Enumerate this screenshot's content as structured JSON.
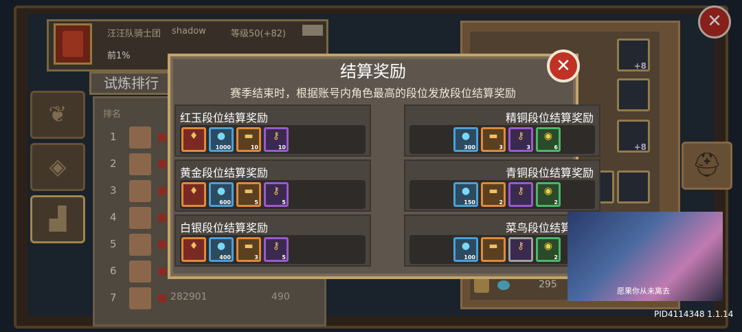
{
  "header": {
    "guild": "汪汪队骑士团",
    "player": "shadow",
    "level": "等级50(+82)",
    "rank_pct": "前1%",
    "tab": "试炼排行"
  },
  "rank_list": {
    "header_label": "排名",
    "rows": [
      {
        "rank": "1",
        "id": "",
        "score": ""
      },
      {
        "rank": "2",
        "id": "",
        "score": ""
      },
      {
        "rank": "3",
        "id": "",
        "score": ""
      },
      {
        "rank": "4",
        "id": "",
        "score": ""
      },
      {
        "rank": "5",
        "id": "",
        "score": ""
      },
      {
        "rank": "6",
        "id": "",
        "score": ""
      },
      {
        "rank": "7",
        "id": "282901",
        "score": "490"
      }
    ]
  },
  "right_panel": {
    "slot_badges": [
      "+8",
      "",
      "+8"
    ],
    "coin_value": "295"
  },
  "modal": {
    "title": "结算奖励",
    "subtitle": "赛季结束时，根据账号内角色最高的段位发放段位结算奖励",
    "tiers": [
      {
        "label": "红玉段位结算奖励",
        "items": [
          {
            "kind": "gem",
            "icon": "chest-icon",
            "qty": ""
          },
          {
            "kind": "crystal",
            "icon": "crystal-icon",
            "qty": "1000"
          },
          {
            "kind": "ticket",
            "icon": "ticket-icon",
            "qty": "10"
          },
          {
            "kind": "key",
            "icon": "key-icon",
            "qty": "10"
          }
        ]
      },
      {
        "label": "精铜段位结算奖励",
        "items": [
          {
            "kind": "crystal",
            "icon": "crystal-icon",
            "qty": "300"
          },
          {
            "kind": "ticket",
            "icon": "ticket-icon",
            "qty": "3"
          },
          {
            "kind": "key",
            "icon": "key-icon",
            "qty": "3"
          },
          {
            "kind": "coin",
            "icon": "coin-icon",
            "qty": "6"
          }
        ]
      },
      {
        "label": "黄金段位结算奖励",
        "items": [
          {
            "kind": "gem",
            "icon": "chest-icon",
            "qty": ""
          },
          {
            "kind": "crystal",
            "icon": "crystal-icon",
            "qty": "600"
          },
          {
            "kind": "ticket",
            "icon": "ticket-icon",
            "qty": "5"
          },
          {
            "kind": "key",
            "icon": "key-icon",
            "qty": "5"
          }
        ]
      },
      {
        "label": "青铜段位结算奖励",
        "items": [
          {
            "kind": "crystal",
            "icon": "crystal-icon",
            "qty": "150"
          },
          {
            "kind": "ticket",
            "icon": "ticket-icon",
            "qty": "2"
          },
          {
            "kind": "key",
            "icon": "key-icon",
            "qty": ""
          },
          {
            "kind": "coin",
            "icon": "coin-icon",
            "qty": "2"
          }
        ]
      },
      {
        "label": "白银段位结算奖励",
        "items": [
          {
            "kind": "gem",
            "icon": "chest-icon",
            "qty": ""
          },
          {
            "kind": "crystal",
            "icon": "crystal-icon",
            "qty": "400"
          },
          {
            "kind": "ticket",
            "icon": "ticket-icon",
            "qty": "3"
          },
          {
            "kind": "key",
            "icon": "key-icon",
            "qty": "5"
          }
        ]
      },
      {
        "label": "菜鸟段位结算奖励",
        "items": [
          {
            "kind": "crystal",
            "icon": "crystal-icon",
            "qty": "100"
          },
          {
            "kind": "ticket",
            "icon": "ticket-icon",
            "qty": ""
          },
          {
            "kind": "key",
            "icon": "key-icon",
            "qty": ""
          },
          {
            "kind": "coin",
            "icon": "coin-icon",
            "qty": "2"
          }
        ]
      }
    ]
  },
  "video": {
    "caption": "愿果你从未离去"
  },
  "footer": {
    "pid": "PID4114348 1.1.14"
  },
  "colors": {
    "gold_border": "#c2a46a",
    "close_red": "#c03224",
    "purple_border": "#9a5ad0",
    "blue_border": "#4aa0d8",
    "orange_border": "#e08a3a",
    "green_border": "#4ab86a",
    "gray_border": "#a0a0a0"
  }
}
